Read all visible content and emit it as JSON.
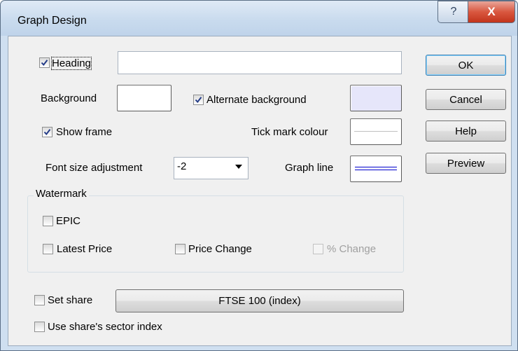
{
  "window": {
    "title": "Graph Design",
    "help_glyph": "?",
    "close_glyph": "X"
  },
  "heading": {
    "label": "Heading",
    "checked": true,
    "value": ""
  },
  "background": {
    "label": "Background",
    "color": "#ffffff"
  },
  "alternate_background": {
    "label": "Alternate background",
    "checked": true,
    "color": "#e6e6fa"
  },
  "show_frame": {
    "label": "Show frame",
    "checked": true
  },
  "tick_mark": {
    "label": "Tick mark colour",
    "color": "#c0c0c0"
  },
  "font_size": {
    "label": "Font size adjustment",
    "value": "-2"
  },
  "graph_line": {
    "label": "Graph line",
    "color": "#0000cc"
  },
  "watermark": {
    "title": "Watermark",
    "epic": {
      "label": "EPIC",
      "checked": false
    },
    "latest_price": {
      "label": "Latest Price",
      "checked": false
    },
    "price_change": {
      "label": "Price Change",
      "checked": false
    },
    "pct_change": {
      "label": "% Change",
      "checked": false,
      "disabled": true
    }
  },
  "set_share": {
    "label": "Set share",
    "checked": false,
    "button_label": "FTSE 100 (index)"
  },
  "sector_index": {
    "label": "Use share's sector index",
    "checked": false
  },
  "buttons": {
    "ok": "OK",
    "cancel": "Cancel",
    "help": "Help",
    "preview": "Preview"
  }
}
